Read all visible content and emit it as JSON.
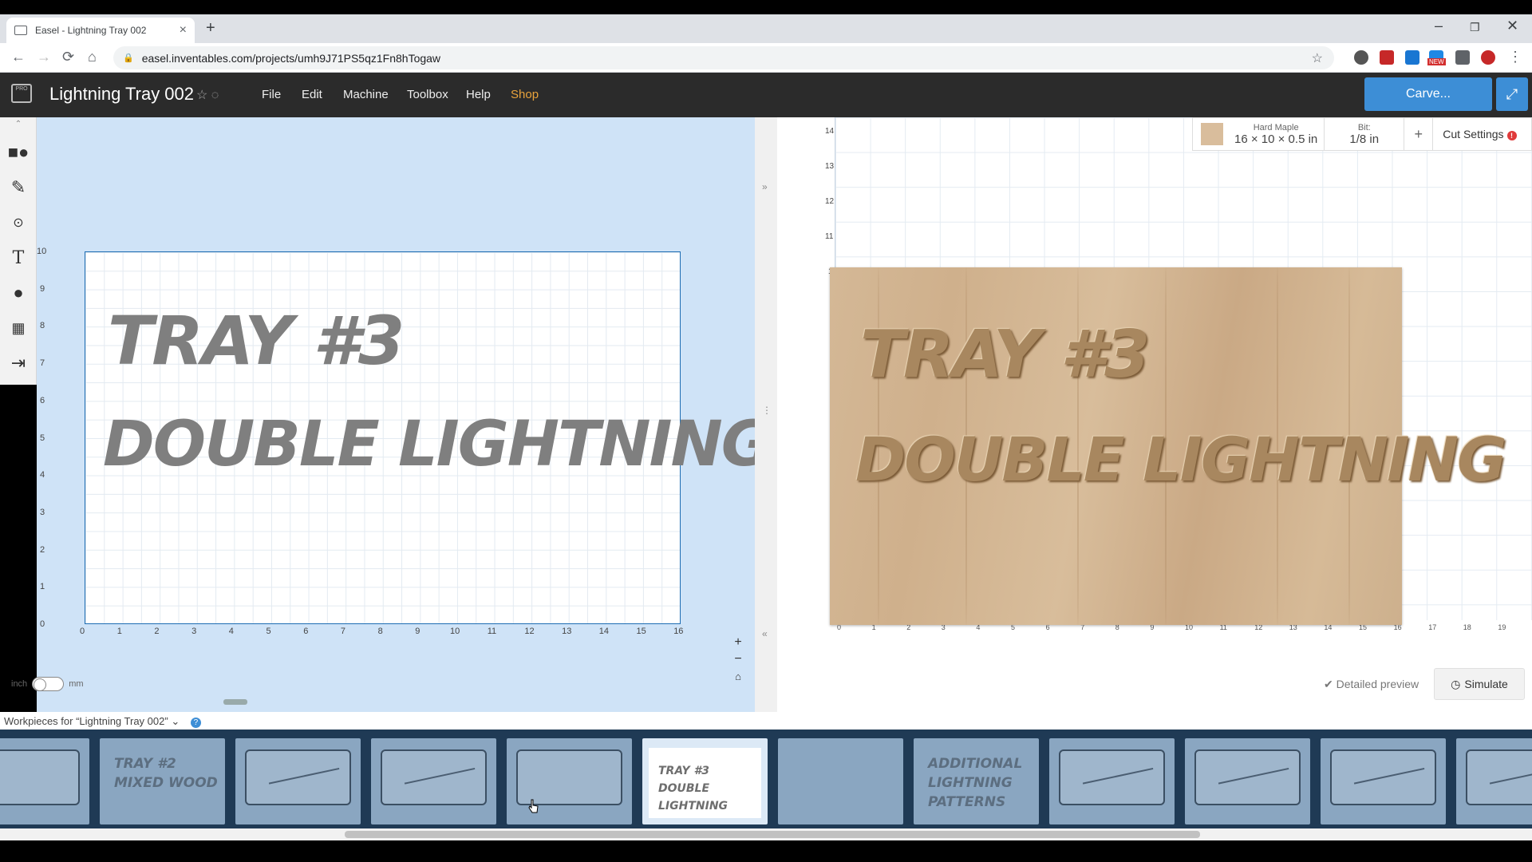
{
  "browser": {
    "tab_title": "Easel - Lightning Tray 002",
    "url": "easel.inventables.com/projects/umh9J71PS5qz1Fn8hTogaw",
    "ext_new_badge": "NEW"
  },
  "app": {
    "logo_text": "PRO",
    "project_title": "Lightning Tray 002",
    "menu": [
      "File",
      "Edit",
      "Machine",
      "Toolbox",
      "Help",
      "Shop"
    ],
    "carve_label": "Carve...",
    "accent": "#3d8ed6",
    "shop_color": "#e8a33c"
  },
  "design": {
    "line1": "TRAY #3",
    "line2": "DOUBLE LIGHTNING",
    "y_ticks": [
      "10",
      "9",
      "8",
      "7",
      "6",
      "5",
      "4",
      "3",
      "2",
      "1",
      "0"
    ],
    "x_ticks": [
      "0",
      "1",
      "2",
      "3",
      "4",
      "5",
      "6",
      "7",
      "8",
      "9",
      "10",
      "11",
      "12",
      "13",
      "14",
      "15",
      "16"
    ],
    "unit_left": "inch",
    "unit_right": "mm"
  },
  "preview": {
    "material_name": "Hard Maple",
    "material_size": "16 × 10 × 0.5 in",
    "bit_label": "Bit:",
    "bit_value": "1/8 in",
    "plus": "+",
    "cut_settings": "Cut Settings",
    "warn": "!",
    "line1": "TRAY #3",
    "line2": "DOUBLE LIGHTNING",
    "y_ticks": [
      "14",
      "13",
      "12",
      "11",
      "1"
    ],
    "x_ticks": [
      "0",
      "1",
      "2",
      "3",
      "4",
      "5",
      "6",
      "7",
      "8",
      "9",
      "10",
      "11",
      "12",
      "13",
      "14",
      "15",
      "16",
      "17",
      "18",
      "19"
    ],
    "detailed_preview": "Detailed preview",
    "simulate": "Simulate"
  },
  "workpieces": {
    "header": "Workpieces for “Lightning Tray 002”",
    "help": "?",
    "cards": [
      {
        "label": ""
      },
      {
        "label": "TRAY #2\nMIXED WOOD"
      },
      {
        "label": ""
      },
      {
        "label": ""
      },
      {
        "label": ""
      },
      {
        "label": "TRAY #3\nDOUBLE LIGHTNING"
      },
      {
        "label": ""
      },
      {
        "label": "ADDITIONAL\nLIGHTNING\nPATTERNS"
      },
      {
        "label": ""
      },
      {
        "label": ""
      },
      {
        "label": ""
      },
      {
        "label": ""
      }
    ]
  }
}
